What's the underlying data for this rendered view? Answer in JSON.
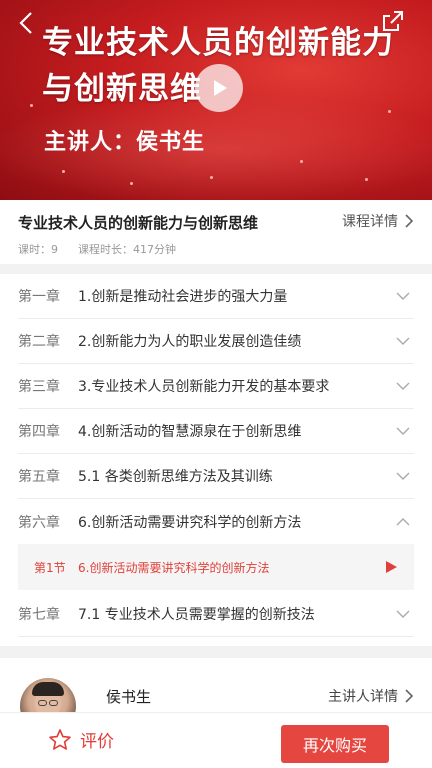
{
  "banner": {
    "title": "专业技术人员的创新能力与创新思维",
    "speaker": "主讲人：侯书生"
  },
  "course": {
    "title": "专业技术人员的创新能力与创新思维",
    "detail_link": "课程详情",
    "lessons": "课时：9",
    "duration": "课程时长：417分钟"
  },
  "chapters": [
    {
      "label": "第一章",
      "title": "1.创新是推动社会进步的强大力量",
      "expanded": false
    },
    {
      "label": "第二章",
      "title": "2.创新能力为人的职业发展创造佳绩",
      "expanded": false
    },
    {
      "label": "第三章",
      "title": "3.专业技术人员创新能力开发的基本要求",
      "expanded": false
    },
    {
      "label": "第四章",
      "title": "4.创新活动的智慧源泉在于创新思维",
      "expanded": false
    },
    {
      "label": "第五章",
      "title": "5.1  各类创新思维方法及其训练",
      "expanded": false
    },
    {
      "label": "第六章",
      "title": "6.创新活动需要讲究科学的创新方法",
      "expanded": true
    },
    {
      "label": "第七章",
      "title": "7.1 专业技术人员需要掌握的创新技法",
      "expanded": false
    }
  ],
  "section": {
    "label": "第1节",
    "title": "6.创新活动需要讲究科学的创新方法"
  },
  "speaker": {
    "name": "侯书生",
    "detail_link": "主讲人详情"
  },
  "bottom": {
    "review": "评价",
    "buy": "再次购买"
  },
  "colors": {
    "accent": "#e5463f",
    "banner": "#c41c1f"
  },
  "icons": {
    "back": "chevron-left-icon",
    "share": "share-icon",
    "play": "play-icon",
    "expand": "chevron-down-icon",
    "collapse": "chevron-up-icon",
    "review": "star-icon"
  }
}
